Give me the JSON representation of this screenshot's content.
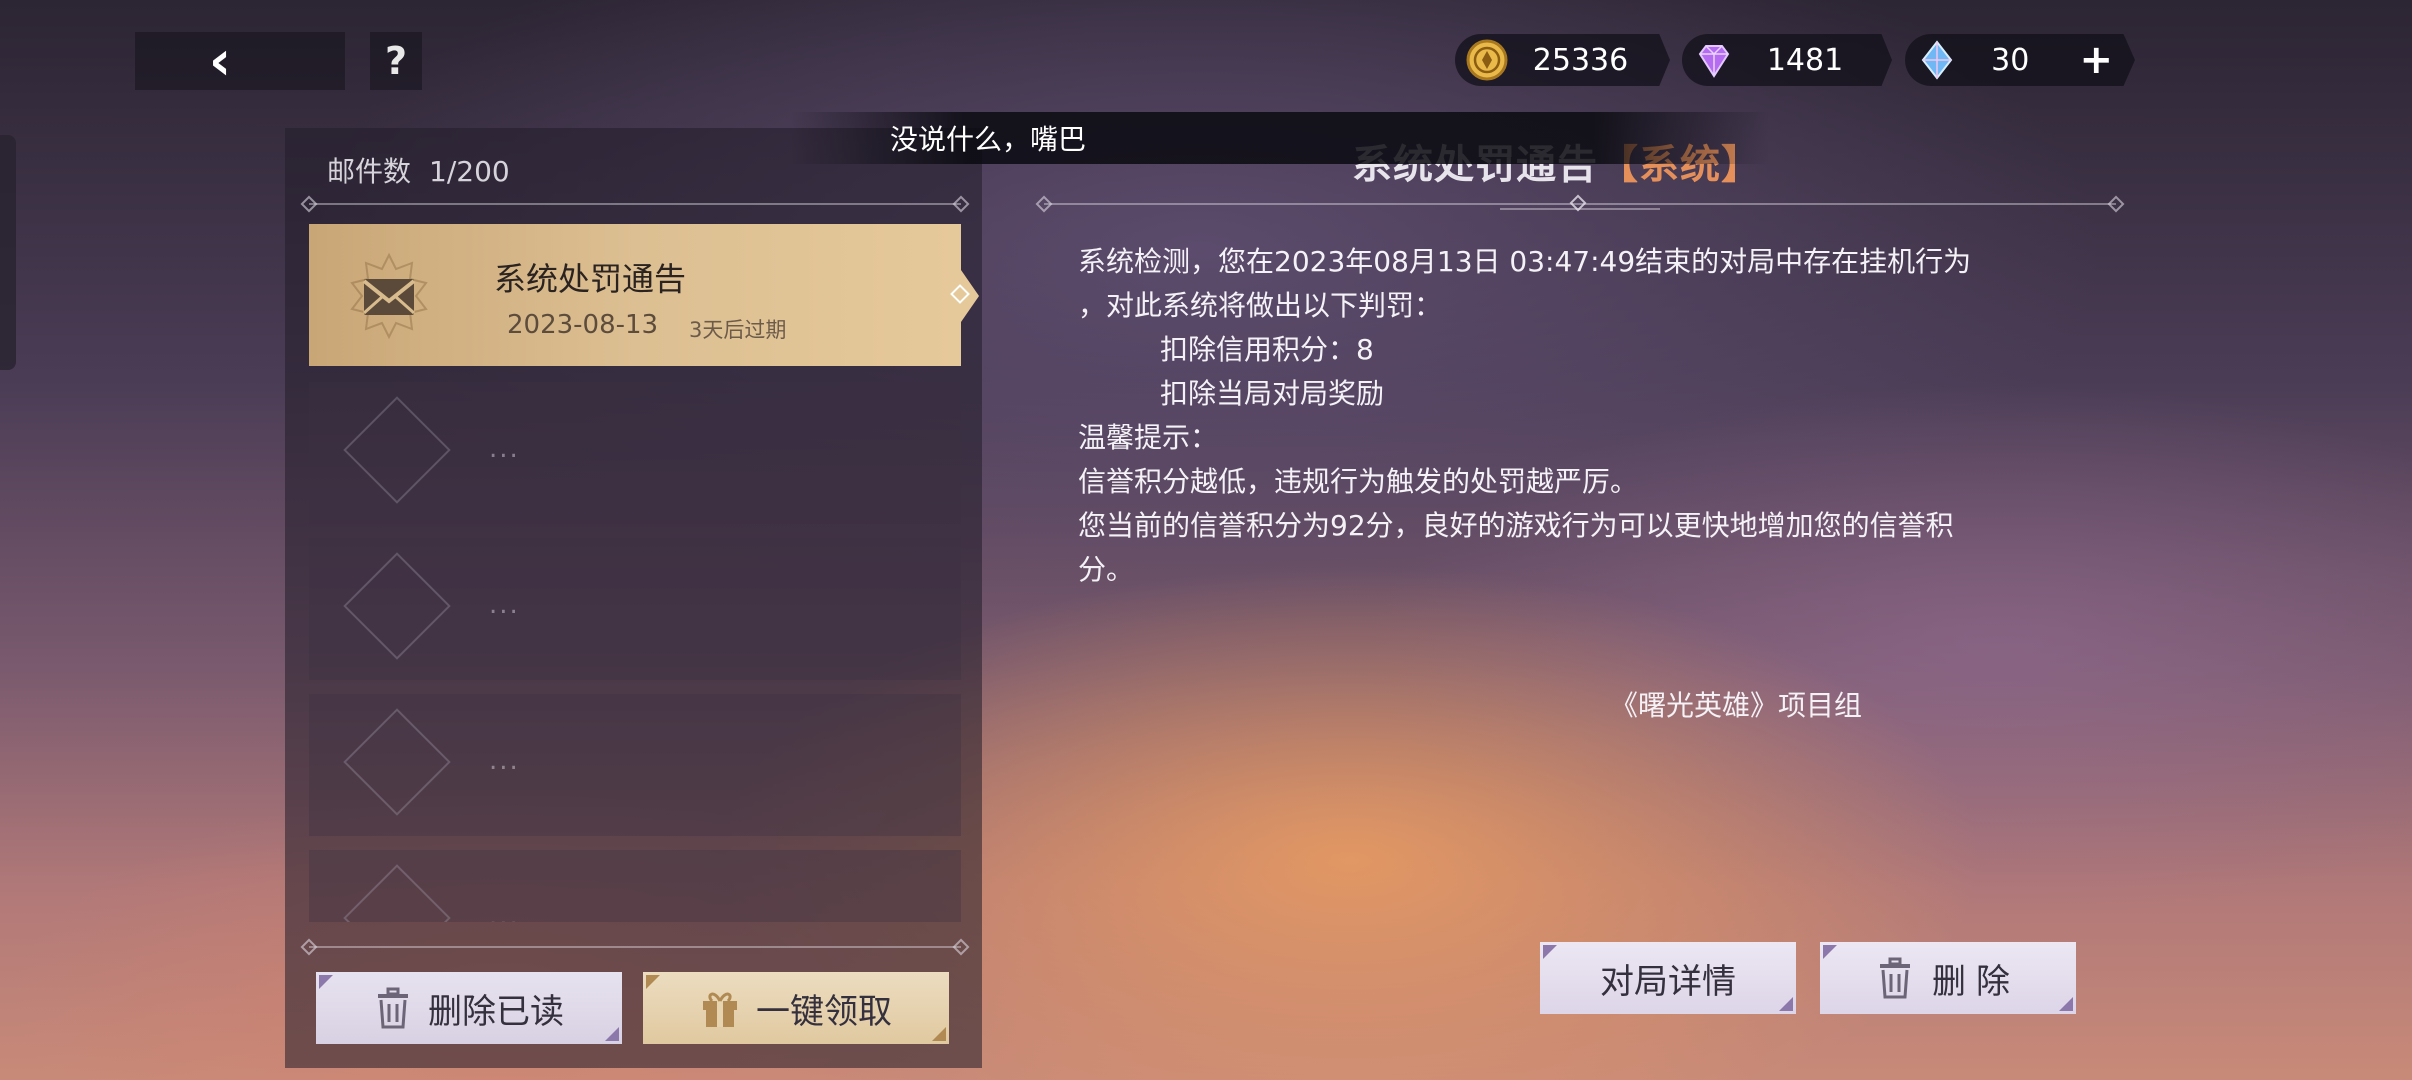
{
  "currencies": {
    "gold": "25336",
    "purple_gem": "1481",
    "blue_gem": "30",
    "plus": "+"
  },
  "toast": "没说什么，嘴巴",
  "mailbox": {
    "count_label": "邮件数",
    "count_value": "1/200",
    "items": [
      {
        "title": "系统处罚通告",
        "date": "2023-08-13",
        "expire": "3天后过期"
      }
    ],
    "empty_placeholder": "...",
    "delete_read_label": "删除已读",
    "claim_all_label": "一键领取"
  },
  "mail_detail": {
    "title": "系统处罚通告",
    "tag": "【系统】",
    "lines": [
      "系统检测，您在2023年08月13日 03:47:49结束的对局中存在挂机行为",
      "，对此系统将做出以下判罚：",
      "扣除信用积分：8",
      "扣除当局对局奖励",
      "温馨提示：",
      "信誉积分越低，违规行为触发的处罚越严厉。",
      "您当前的信誉积分为92分，良好的游戏行为可以更快地增加您的信誉积",
      "分。"
    ],
    "signature": "《曙光英雄》项目组",
    "match_details_label": "对局详情",
    "delete_label": "删除"
  },
  "colors": {
    "tag_orange": "#e58f5a",
    "selected_mail_gold": "#dcbf92",
    "button_lilac": "#e7e2ef"
  },
  "icons": {
    "back": "chevron-left-icon",
    "help": "question-icon",
    "gold": "coin-icon",
    "purple": "purple-diamond-icon",
    "blue": "blue-crystal-icon",
    "mail": "envelope-icon",
    "trash": "trash-icon",
    "gift": "gift-icon"
  }
}
